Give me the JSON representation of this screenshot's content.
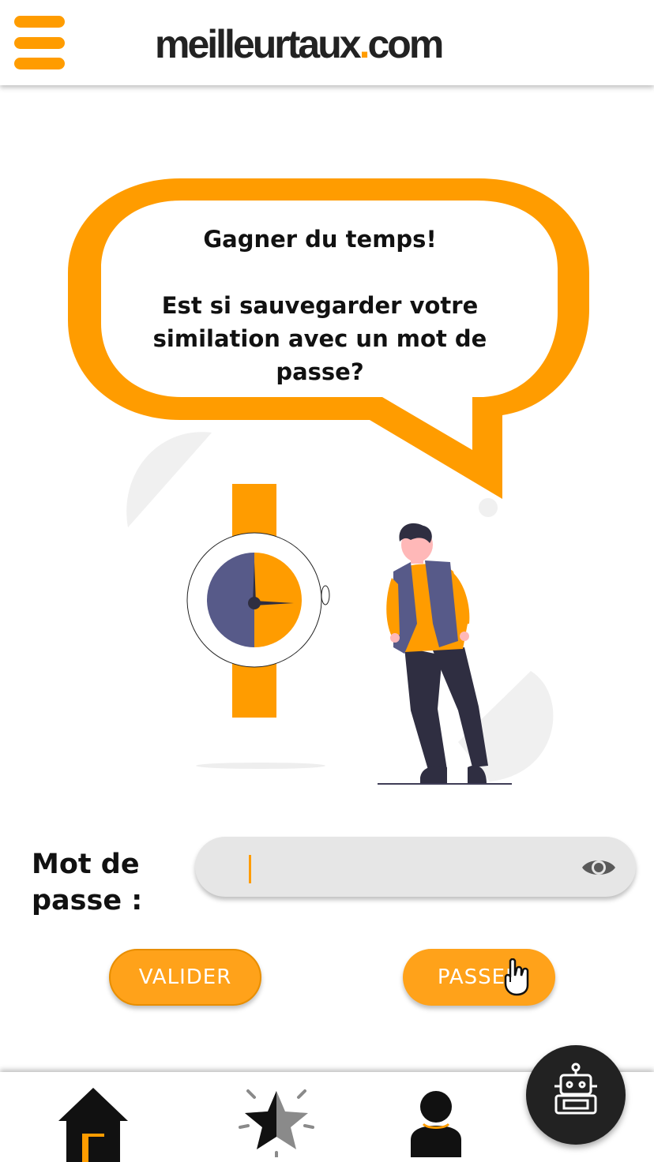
{
  "header": {
    "logo_text_main": "meilleurtaux",
    "logo_dot": ".",
    "logo_text_tld": "com",
    "menu_icon": "hamburger-menu-icon"
  },
  "speech_bubble": {
    "title": "Gagner du temps!",
    "question_line1": "Est si sauvegarder votre",
    "question_line2": "similation avec un mot de",
    "question_line3": "passe?"
  },
  "password": {
    "label_line1": "Mot de",
    "label_line2": "passe :",
    "value": "",
    "toggle_icon": "eye-icon"
  },
  "buttons": {
    "validate_label": "VALIDER",
    "skip_label": "PASSER"
  },
  "bottom_nav": {
    "items": [
      {
        "icon": "home-icon"
      },
      {
        "icon": "star-icon"
      },
      {
        "icon": "user-icon"
      }
    ],
    "fab_icon": "robot-icon"
  },
  "colors": {
    "accent": "#ff9c00",
    "button": "#ffa21a",
    "dark": "#222222",
    "field": "#e6e6e6",
    "illustration_purple": "#575a89"
  }
}
